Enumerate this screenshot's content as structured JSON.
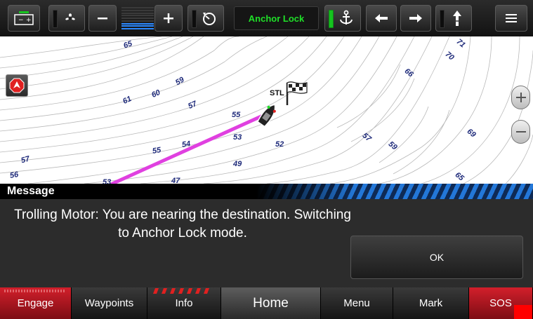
{
  "toolbar": {
    "battery_icon": "battery-icon",
    "anchor_mode_label": "Anchor Lock",
    "menu_icon": "hamburger-menu-icon"
  },
  "chart": {
    "destination_label": "STL",
    "depths": [
      "65",
      "71",
      "70",
      "66",
      "61",
      "60",
      "59",
      "57",
      "55",
      "53",
      "54",
      "52",
      "55",
      "57",
      "59",
      "57",
      "56",
      "69",
      "49",
      "65",
      "53",
      "47"
    ]
  },
  "message": {
    "title": "Message",
    "body": "Trolling Motor: You are nearing the destination. Switching to Anchor Lock mode.",
    "ok_label": "OK"
  },
  "bottom_bar": {
    "engage": "Engage",
    "waypoints": "Waypoints",
    "info": "Info",
    "home": "Home",
    "menu": "Menu",
    "mark": "Mark",
    "sos": "SOS"
  },
  "colors": {
    "route": "#e040e0",
    "accent_green": "#1fe028",
    "alert_red": "#d21f2b",
    "stripe_blue": "#2377d8"
  }
}
